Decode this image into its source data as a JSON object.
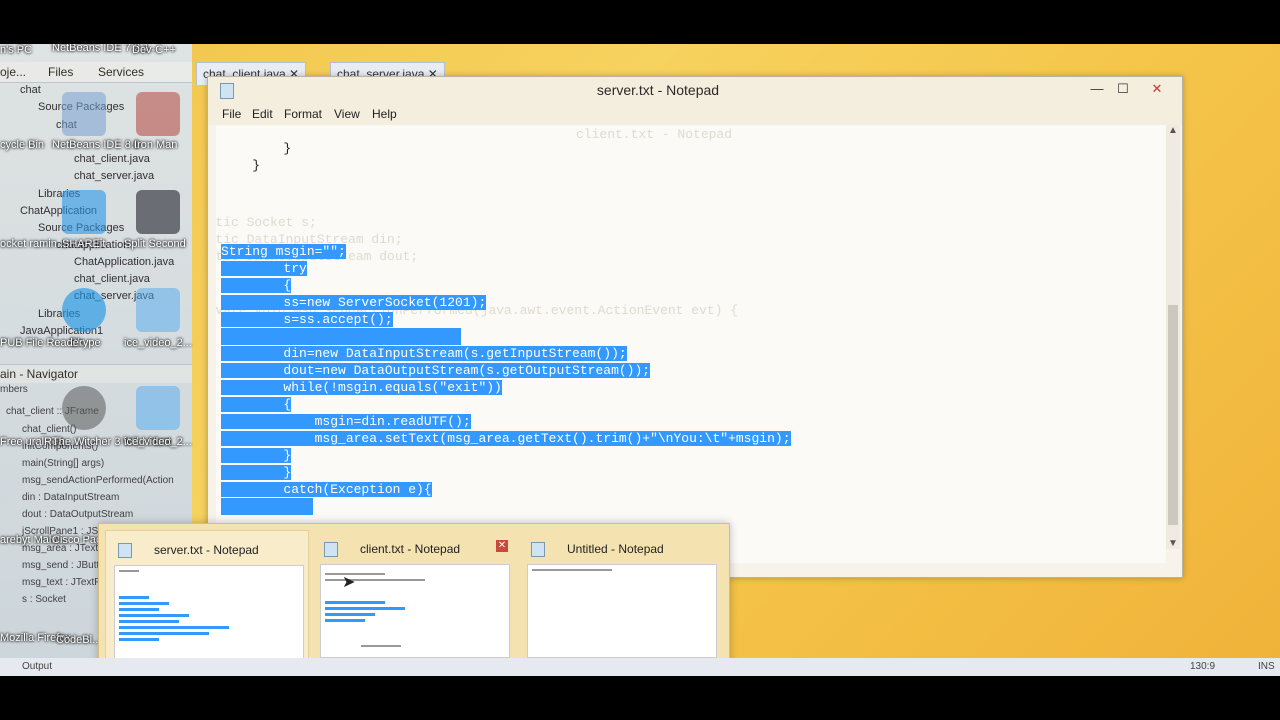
{
  "netbeans": {
    "tabs": [
      "oje...",
      "Files",
      "Services"
    ],
    "editor_tabs": [
      "chat_client.java",
      "chat_server.java"
    ],
    "tree": [
      "chat",
      "Source Packages",
      "chat",
      "chat_client.java",
      "chat_server.java",
      "Libraries",
      "ChatApplication",
      "Source Packages",
      "chatapplication",
      "ChatApplication.java",
      "chat_client.java",
      "chat_server.java",
      "Libraries",
      "JavaApplication1"
    ],
    "navigator_title": "ain - Navigator",
    "navigator_items": [
      "mbers",
      "chat_client :: JFrame",
      "chat_client()",
      "initComponents()",
      "main(String[] args)",
      "msg_sendActionPerformed(Action",
      "din : DataInputStream",
      "dout : DataOutputStream",
      "jScrollPane1 : JScrollPane",
      "msg_area : JTextArea",
      "msg_send : JButton",
      "msg_text : JTextField",
      "s : Socket"
    ],
    "output_label": "Output",
    "status_pos": "130:9",
    "status_mode": "INS"
  },
  "desktop_icons": [
    "n's PC",
    "NetBeans IDE 7.2.1",
    "Dev-C++",
    "cycle Bin",
    "NetBeans IDE 8.0",
    "Iron Man",
    "SHAREit",
    "Split Second",
    "ocket ramin...",
    "Skype",
    "ice_video_2...",
    "PUB File Reader",
    "Free uralRea...",
    "The Witcher 3 Wild Hunt",
    "ice_video_2...",
    "arebyt Malw...",
    "Cisco Pack...",
    "Mozilla Firefox",
    "CodeBl..."
  ],
  "notepad": {
    "title": "server.txt - Notepad",
    "minimize": "—",
    "maximize": "☐",
    "close": "✕",
    "menu": [
      "File",
      "Edit",
      "Format",
      "View",
      "Help"
    ],
    "code_lines": [
      {
        "text": "        }",
        "selected": false
      },
      {
        "text": "    }",
        "selected": false
      },
      {
        "text": "String msgin=\"\";",
        "selected": true
      },
      {
        "text": "        try",
        "selected": true
      },
      {
        "text": "        {",
        "selected": true
      },
      {
        "text": "        ss=new ServerSocket(1201);",
        "selected": true
      },
      {
        "text": "        s=ss.accept();",
        "selected": true
      },
      {
        "text": "",
        "selected": true
      },
      {
        "text": "        din=new DataInputStream(s.getInputStream());",
        "selected": true
      },
      {
        "text": "        dout=new DataOutputStream(s.getOutputStream());",
        "selected": true
      },
      {
        "text": "        while(!msgin.equals(\"exit\"))",
        "selected": true
      },
      {
        "text": "        {",
        "selected": true
      },
      {
        "text": "            msgin=din.readUTF();",
        "selected": true
      },
      {
        "text": "            msg_area.setText(msg_area.getText().trim()+\"\\nYou:\\t\"+msgin);",
        "selected": true
      },
      {
        "text": "        }",
        "selected": true
      },
      {
        "text": "        }",
        "selected": true
      },
      {
        "text": "        catch(Exception e){",
        "selected": true
      }
    ],
    "ghost_lines": [
      "client.txt - Notepad",
      "static Socket s;",
      "static DataInputStream din;",
      "static DataOutputStream dout;",
      "private void msg_sendActionPerformed(java.awt.event.ActionEvent evt) {"
    ]
  },
  "taskbar_thumbnails": [
    {
      "title": "server.txt - Notepad",
      "active": true
    },
    {
      "title": "client.txt - Notepad",
      "active": false,
      "close": "✕"
    },
    {
      "title": "Untitled - Notepad",
      "active": false
    }
  ]
}
